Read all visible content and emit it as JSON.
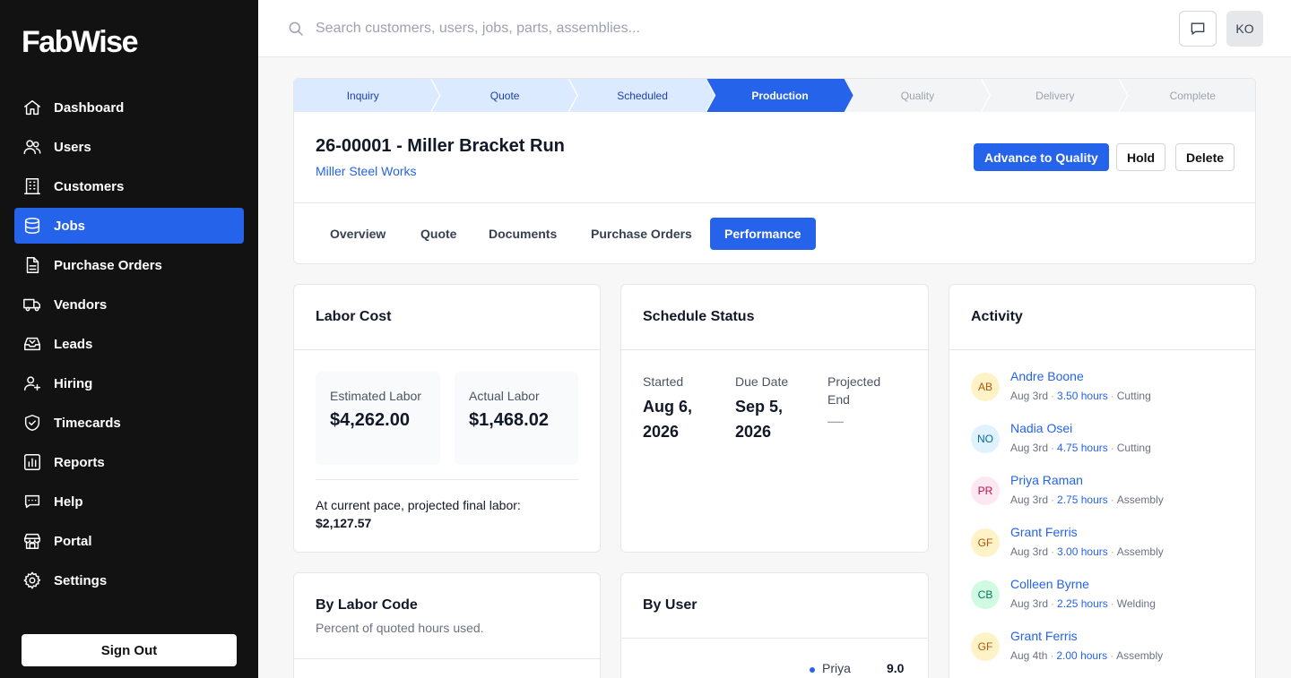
{
  "app": {
    "name": "FabWise"
  },
  "sidebar": {
    "items": [
      {
        "label": "Dashboard",
        "icon": "home-icon",
        "active": false
      },
      {
        "label": "Users",
        "icon": "users-icon",
        "active": false
      },
      {
        "label": "Customers",
        "icon": "building-icon",
        "active": false
      },
      {
        "label": "Jobs",
        "icon": "database-icon",
        "active": true
      },
      {
        "label": "Purchase Orders",
        "icon": "document-icon",
        "active": false
      },
      {
        "label": "Vendors",
        "icon": "truck-icon",
        "active": false
      },
      {
        "label": "Leads",
        "icon": "inbox-icon",
        "active": false
      },
      {
        "label": "Hiring",
        "icon": "user-plus-icon",
        "active": false
      },
      {
        "label": "Timecards",
        "icon": "shield-check-icon",
        "active": false
      },
      {
        "label": "Reports",
        "icon": "bar-chart-icon",
        "active": false
      },
      {
        "label": "Help",
        "icon": "chat-bubble-icon",
        "active": false
      },
      {
        "label": "Portal",
        "icon": "storefront-icon",
        "active": false
      },
      {
        "label": "Settings",
        "icon": "gear-icon",
        "active": false
      }
    ],
    "signout_label": "Sign Out"
  },
  "header": {
    "search_placeholder": "Search customers, users, jobs, parts, assemblies...",
    "avatar_initials": "KO"
  },
  "job": {
    "stages": [
      {
        "label": "Inquiry",
        "state": "done"
      },
      {
        "label": "Quote",
        "state": "done"
      },
      {
        "label": "Scheduled",
        "state": "done"
      },
      {
        "label": "Production",
        "state": "current"
      },
      {
        "label": "Quality",
        "state": "todo"
      },
      {
        "label": "Delivery",
        "state": "todo"
      },
      {
        "label": "Complete",
        "state": "todo"
      }
    ],
    "title": "26-00001 - Miller Bracket Run",
    "customer": "Miller Steel Works",
    "actions": {
      "advance": "Advance to Quality",
      "hold": "Hold",
      "delete": "Delete"
    },
    "tabs": [
      {
        "label": "Overview",
        "active": false
      },
      {
        "label": "Quote",
        "active": false
      },
      {
        "label": "Documents",
        "active": false
      },
      {
        "label": "Purchase Orders",
        "active": false
      },
      {
        "label": "Performance",
        "active": true
      }
    ]
  },
  "labor_cost": {
    "title": "Labor Cost",
    "estimated_label": "Estimated Labor",
    "estimated_value": "$4,262.00",
    "actual_label": "Actual Labor",
    "actual_value": "$1,468.02",
    "projection_text": "At current pace, projected final labor:",
    "projection_value": "$2,127.57"
  },
  "schedule": {
    "title": "Schedule Status",
    "started_label": "Started",
    "started_value": "Aug 6, 2026",
    "due_label": "Due Date",
    "due_value": "Sep 5, 2026",
    "projected_label": "Projected End",
    "projected_value": "—"
  },
  "activity": {
    "title": "Activity",
    "items": [
      {
        "initials": "AB",
        "name": "Andre Boone",
        "date": "Aug 3rd",
        "hours": "3.50 hours",
        "code": "Cutting",
        "bg": "#fef3c7",
        "fg": "#b45309"
      },
      {
        "initials": "NO",
        "name": "Nadia Osei",
        "date": "Aug 3rd",
        "hours": "4.75 hours",
        "code": "Cutting",
        "bg": "#e0f2fe",
        "fg": "#0369a1"
      },
      {
        "initials": "PR",
        "name": "Priya Raman",
        "date": "Aug 3rd",
        "hours": "2.75 hours",
        "code": "Assembly",
        "bg": "#fce7f3",
        "fg": "#be123c"
      },
      {
        "initials": "GF",
        "name": "Grant Ferris",
        "date": "Aug 3rd",
        "hours": "3.00 hours",
        "code": "Assembly",
        "bg": "#fef3c7",
        "fg": "#b45309"
      },
      {
        "initials": "CB",
        "name": "Colleen Byrne",
        "date": "Aug 3rd",
        "hours": "2.25 hours",
        "code": "Welding",
        "bg": "#d1fae5",
        "fg": "#047857"
      },
      {
        "initials": "GF",
        "name": "Grant Ferris",
        "date": "Aug 4th",
        "hours": "2.00 hours",
        "code": "Assembly",
        "bg": "#fef3c7",
        "fg": "#b45309"
      }
    ]
  },
  "by_labor_code": {
    "title": "By Labor Code",
    "subtitle": "Percent of quoted hours used."
  },
  "by_user": {
    "title": "By User",
    "first_row": {
      "name": "Priya",
      "value": "9.0"
    }
  }
}
